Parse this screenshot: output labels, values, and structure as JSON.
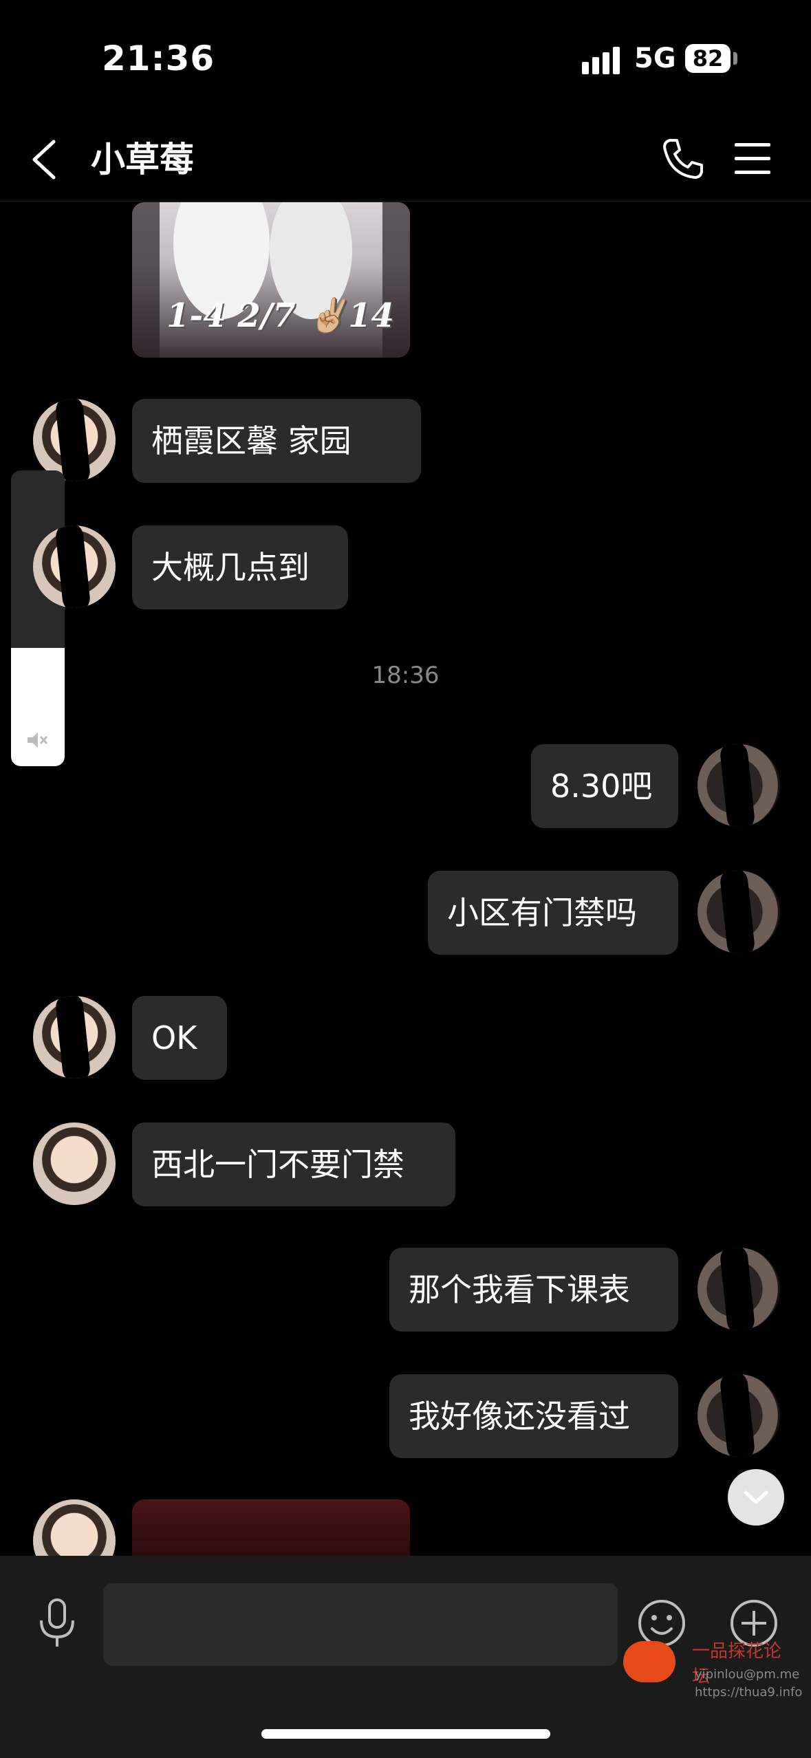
{
  "status_bar": {
    "time": "21:36",
    "network": "5G",
    "battery": "82"
  },
  "header": {
    "title": "小草莓"
  },
  "messages": [
    {
      "side": "left",
      "type": "image",
      "caption": "1-4 2/7 ✌🏼14"
    },
    {
      "side": "left",
      "type": "text",
      "text": "栖霞区馨 家园"
    },
    {
      "side": "left",
      "type": "text",
      "text": "大概几点到"
    },
    {
      "type": "timestamp",
      "text": "18:36"
    },
    {
      "side": "right",
      "type": "text",
      "text": "8.30吧"
    },
    {
      "side": "right",
      "type": "text",
      "text": "小区有门禁吗"
    },
    {
      "side": "left",
      "type": "text",
      "text": "OK"
    },
    {
      "side": "left",
      "type": "text",
      "text": "西北一门不要门禁"
    },
    {
      "side": "right",
      "type": "text",
      "text": "那个我看下课表"
    },
    {
      "side": "right",
      "type": "text",
      "text": "我好像还没看过"
    },
    {
      "side": "left",
      "type": "image",
      "caption": ""
    }
  ],
  "input": {
    "placeholder": ""
  },
  "watermark": {
    "title": "一品探花论坛",
    "line1": "yipinlou@pm.me",
    "line2": "https://thua9.info"
  },
  "colors": {
    "background": "#000000",
    "bubble": "#2b2b2b",
    "input_bar": "#1b1b1b",
    "timestamp": "#8a8a8a"
  },
  "icons": [
    "back-icon",
    "phone-icon",
    "menu-icon",
    "mic-icon",
    "emoji-icon",
    "plus-icon",
    "chevron-down-icon",
    "mute-icon"
  ]
}
